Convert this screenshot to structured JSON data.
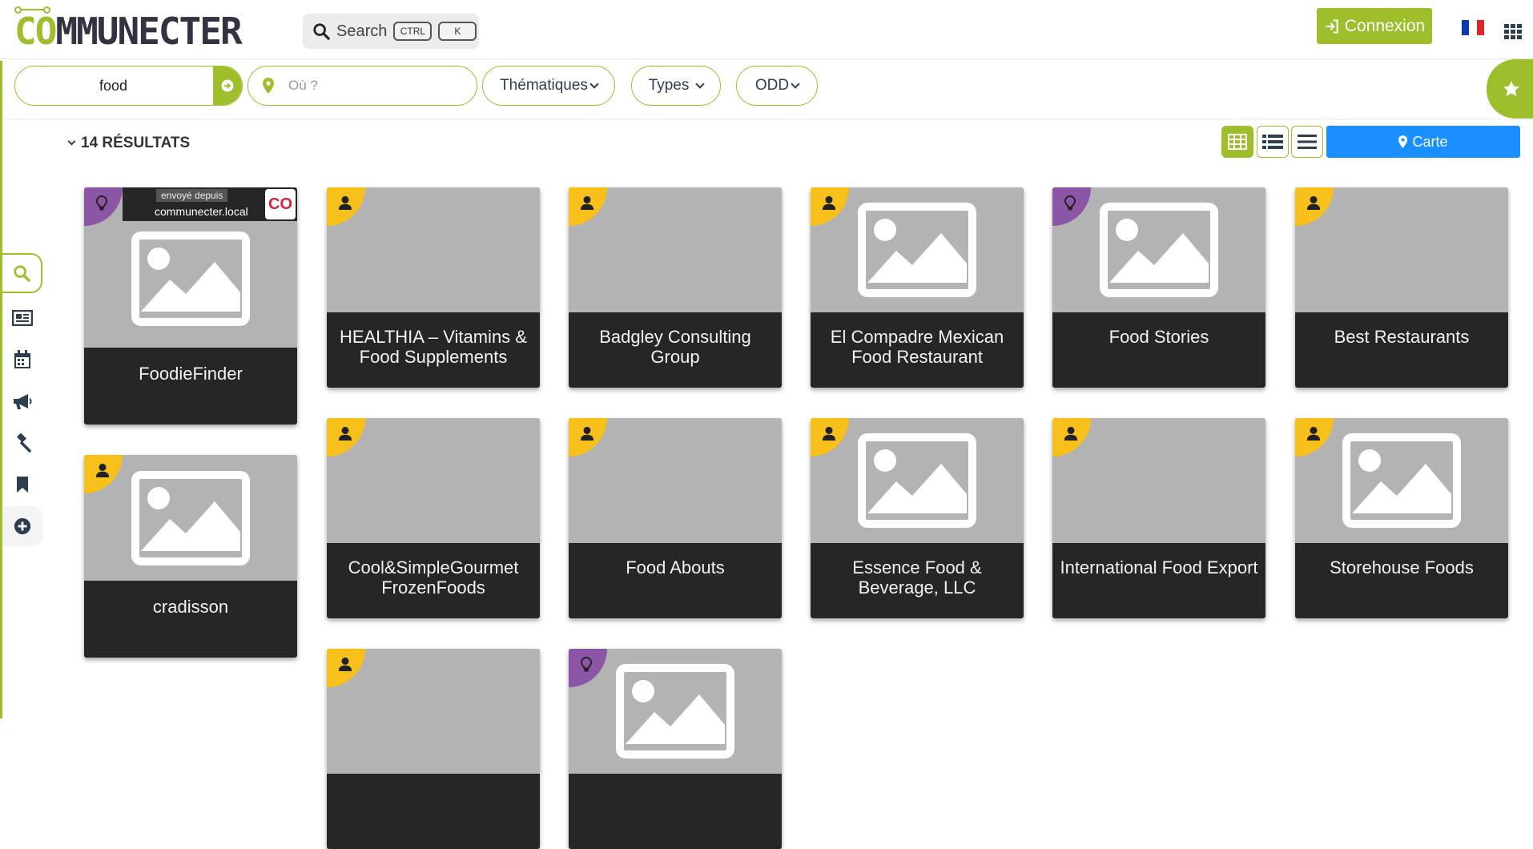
{
  "header": {
    "logo_co": "CO",
    "logo_rest": "MMUNECTER",
    "search_label": "Search",
    "kbd_ctrl": "CTRL",
    "kbd_k": "K",
    "login_label": "Connexion"
  },
  "filters": {
    "keyword_value": "food",
    "where_placeholder": "Où ?",
    "themes_label": "Thématiques",
    "types_label": "Types",
    "odd_label": "ODD"
  },
  "results": {
    "count_label": "14 RÉSULTATS",
    "map_label": "Carte"
  },
  "cards": [
    {
      "title": "FoodieFinder",
      "badge": "lightbulb",
      "image": true,
      "sent_from": "envoyé depuis",
      "source": "communecter.local",
      "source_badge": "CO"
    },
    {
      "title": "HEALTHIA – Vitamins & Food Supplements",
      "badge": "person",
      "image": false
    },
    {
      "title": "Badgley Consulting Group",
      "badge": "person",
      "image": false
    },
    {
      "title": "El Compadre Mexican Food Restaurant",
      "badge": "person",
      "image": true
    },
    {
      "title": "Food Stories",
      "badge": "lightbulb",
      "image": true
    },
    {
      "title": "Best Restaurants",
      "badge": "person",
      "image": false
    },
    {
      "title": "cradisson",
      "badge": "person",
      "image": true
    },
    {
      "title": "Cool&SimpleGourmet FrozenFoods",
      "badge": "person",
      "image": false
    },
    {
      "title": "Food Abouts",
      "badge": "person",
      "image": false
    },
    {
      "title": "Essence Food & Beverage, LLC",
      "badge": "person",
      "image": true
    },
    {
      "title": "International Food Export",
      "badge": "person",
      "image": false
    },
    {
      "title": "Storehouse Foods",
      "badge": "person",
      "image": true
    },
    {
      "title": "",
      "badge": "person",
      "image": false
    },
    {
      "title": "",
      "badge": "lightbulb",
      "image": true
    }
  ],
  "colors": {
    "brand_green": "#9ebe2c",
    "badge_yellow": "#f7c01a",
    "badge_purple": "#8c56a6",
    "map_blue": "#1a8fff",
    "card_title_bg": "#262626"
  }
}
